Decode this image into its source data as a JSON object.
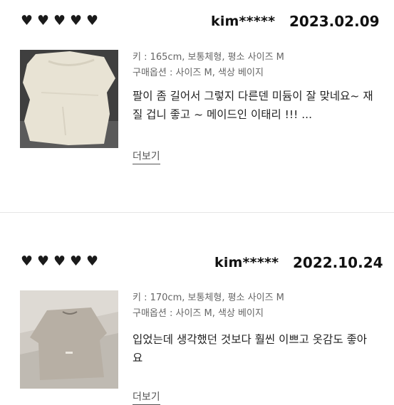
{
  "reviews": [
    {
      "stars": [
        "♥",
        "♥",
        "♥",
        "♥",
        "♥"
      ],
      "user": "kim*****",
      "date": "2023.02.09",
      "meta_line1": "키 : 165cm, 보통체형, 평소 사이즈 M",
      "meta_line2": "구매옵션 : 사이즈 M, 색상 베이지",
      "body": "팔이 좀 길어서 그렇지 다른덴 미듐이 잘 맞네요~ 재질 겁니 좋고 ~ 메이드인 이태리 !!! ...",
      "more": "더보기"
    },
    {
      "stars": [
        "♥",
        "♥",
        "♥",
        "♥",
        "♥"
      ],
      "user": "kim*****",
      "date": "2022.10.24",
      "meta_line1": "키 : 170cm, 보통체형, 평소 사이즈 M",
      "meta_line2": "구매옵션 : 사이즈 M, 색상 베이지",
      "body": "입었는데 생각했던 것보다 훨씬 이쁘고 옷감도 좋아요",
      "more": "더보기"
    }
  ],
  "icons": {
    "rating": "heart-icon",
    "photo": "review-photo"
  },
  "colors": {
    "text": "#111111",
    "meta": "#666666",
    "divider": "#e6e6e6"
  }
}
